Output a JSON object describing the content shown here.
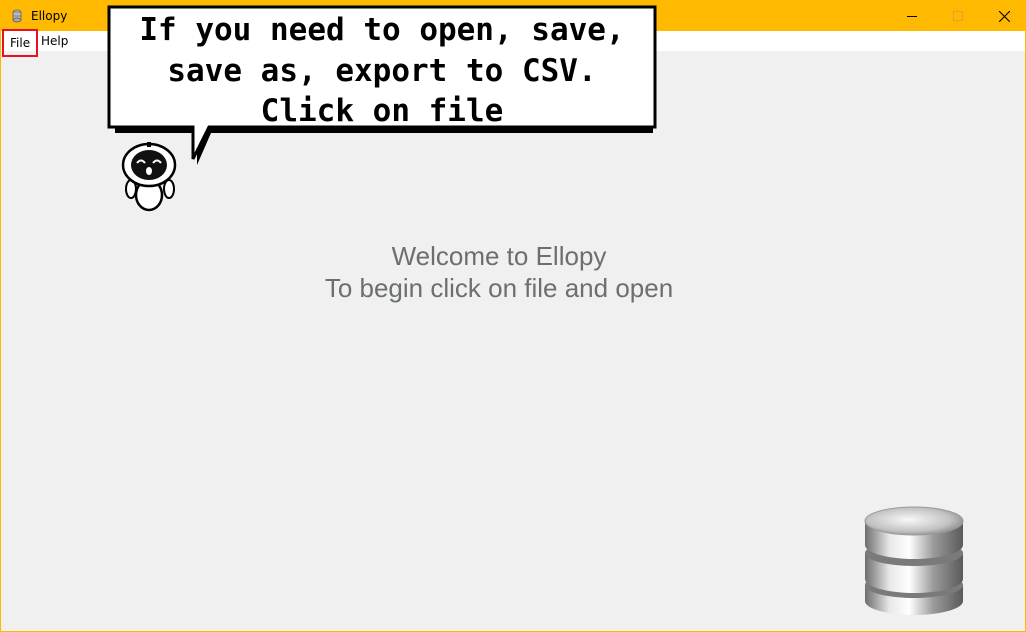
{
  "window": {
    "title": "Ellopy",
    "controls": {
      "minimize": "minimize",
      "maximize": "maximize",
      "close": "close"
    }
  },
  "menu": {
    "file": "File",
    "help": "Help"
  },
  "tooltip": {
    "line1": "If you need to open, save,",
    "line2": "save as, export to CSV.",
    "line3": "Click on file"
  },
  "main": {
    "welcome_line1": "Welcome to Ellopy",
    "welcome_line2": "To begin click on file and open"
  },
  "colors": {
    "titlebar": "#ffb900",
    "highlight_border": "#e81123",
    "text_muted": "#6b6f72"
  },
  "icons": {
    "app": "app-icon",
    "mascot": "robot-mascot-icon",
    "database": "database-icon"
  }
}
